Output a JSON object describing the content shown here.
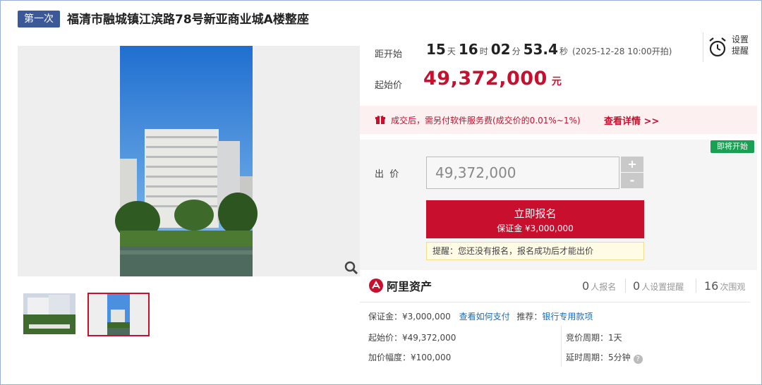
{
  "header": {
    "round_badge": "第一次",
    "title": "福清市融城镇江滨路78号新亚商业城A楼整座"
  },
  "countdown": {
    "label": "距开始",
    "days": "15",
    "days_unit": "天",
    "hours": "16",
    "hours_unit": "时",
    "minutes": "02",
    "minutes_unit": "分",
    "seconds": "53.4",
    "seconds_unit": "秒",
    "start_note": "(2025-12-28 10:00开拍)"
  },
  "reminder": {
    "icon": "alarm-clock-icon",
    "line1": "设置",
    "line2": "提醒"
  },
  "starting_price": {
    "label": "起始价",
    "value": "49,372,000",
    "unit": "元"
  },
  "fee_notice": {
    "text": "成交后，需另付软件服务费(成交价的0.01%~1%)",
    "link": "查看详情 >>"
  },
  "bid": {
    "status_badge": "即将开始",
    "label": "出  价",
    "input_value": "49,372,000",
    "increment": "+",
    "decrement": "-",
    "signup_main": "立即报名",
    "signup_sub": "保证金 ¥3,000,000",
    "tip": "提醒：您还没有报名，报名成功后才能出价"
  },
  "brand": {
    "name": "阿里资产"
  },
  "stats": [
    {
      "num": "0",
      "label": "人报名"
    },
    {
      "num": "0",
      "label": "人设置提醒"
    },
    {
      "num": "16",
      "label": "次围观"
    }
  ],
  "details": {
    "deposit_label": "保证金：",
    "deposit_value": "¥3,000,000",
    "how_to_pay": "查看如何支付",
    "recommend_label": "推荐：",
    "recommend_link": "银行专用款项",
    "start_price_label": "起始价：",
    "start_price_value": "¥49,372,000",
    "increment_label": "加价幅度：",
    "increment_value": "¥100,000",
    "cycle_label": "竞价周期：",
    "cycle_value": "1天",
    "delay_label": "延时周期：",
    "delay_value": "5分钟"
  },
  "colors": {
    "accent_red": "#c8102e",
    "badge_blue": "#3b5998",
    "status_green": "#1aa053",
    "link_blue": "#1a6bbd"
  }
}
